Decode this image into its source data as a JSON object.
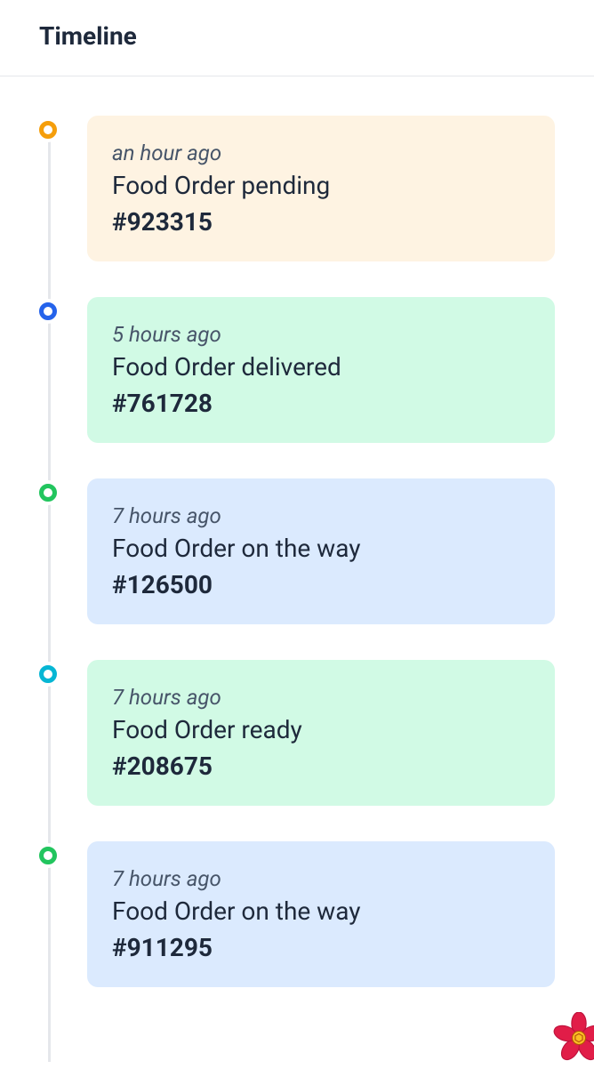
{
  "header": {
    "title": "Timeline"
  },
  "timeline": [
    {
      "time": "an hour ago",
      "title": "Food Order pending",
      "id": "#923315",
      "dotColor": "orange",
      "cardColor": "yellow"
    },
    {
      "time": "5 hours ago",
      "title": "Food Order delivered",
      "id": "#761728",
      "dotColor": "blue",
      "cardColor": "teal"
    },
    {
      "time": "7 hours ago",
      "title": "Food Order on the way",
      "id": "#126500",
      "dotColor": "green",
      "cardColor": "lightblue"
    },
    {
      "time": "7 hours ago",
      "title": "Food Order ready",
      "id": "#208675",
      "dotColor": "cyan",
      "cardColor": "teal"
    },
    {
      "time": "7 hours ago",
      "title": "Food Order on the way",
      "id": "#911295",
      "dotColor": "green",
      "cardColor": "lightblue"
    }
  ]
}
